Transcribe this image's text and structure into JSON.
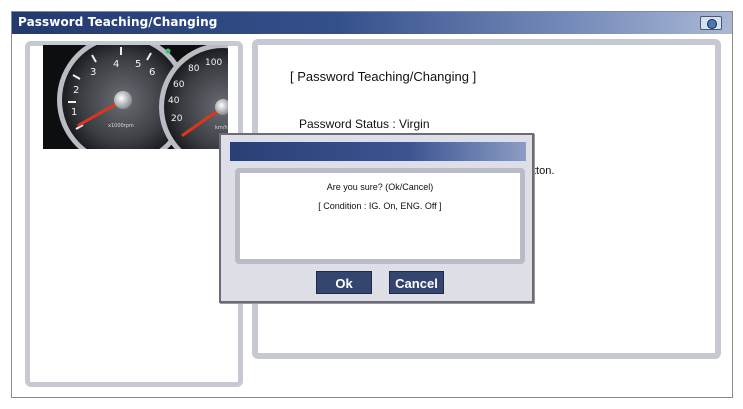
{
  "window": {
    "title": "Password Teaching/Changing",
    "icon": "camera-icon"
  },
  "gauge_panel": {
    "image": "instrument-cluster-gauges",
    "tach_numbers": [
      "1",
      "2",
      "3",
      "4",
      "5",
      "6"
    ],
    "tach_unit": "x1000rpm",
    "speedo_numbers": [
      "20",
      "40",
      "60",
      "80",
      "100"
    ],
    "speedo_unit": "km/h"
  },
  "main": {
    "heading": "[ Password Teaching/Changing ]",
    "status_line": "Password Status : Virgin",
    "instruction_fragment": "tton."
  },
  "dialog": {
    "message": "Are you sure? (Ok/Cancel)",
    "condition": "[ Condition : IG. On, ENG. Off ]",
    "ok_label": "Ok",
    "cancel_label": "Cancel"
  },
  "colors": {
    "title_bar": "#243a6e",
    "panel_border": "#c7c9d2",
    "button": "#34466f"
  }
}
